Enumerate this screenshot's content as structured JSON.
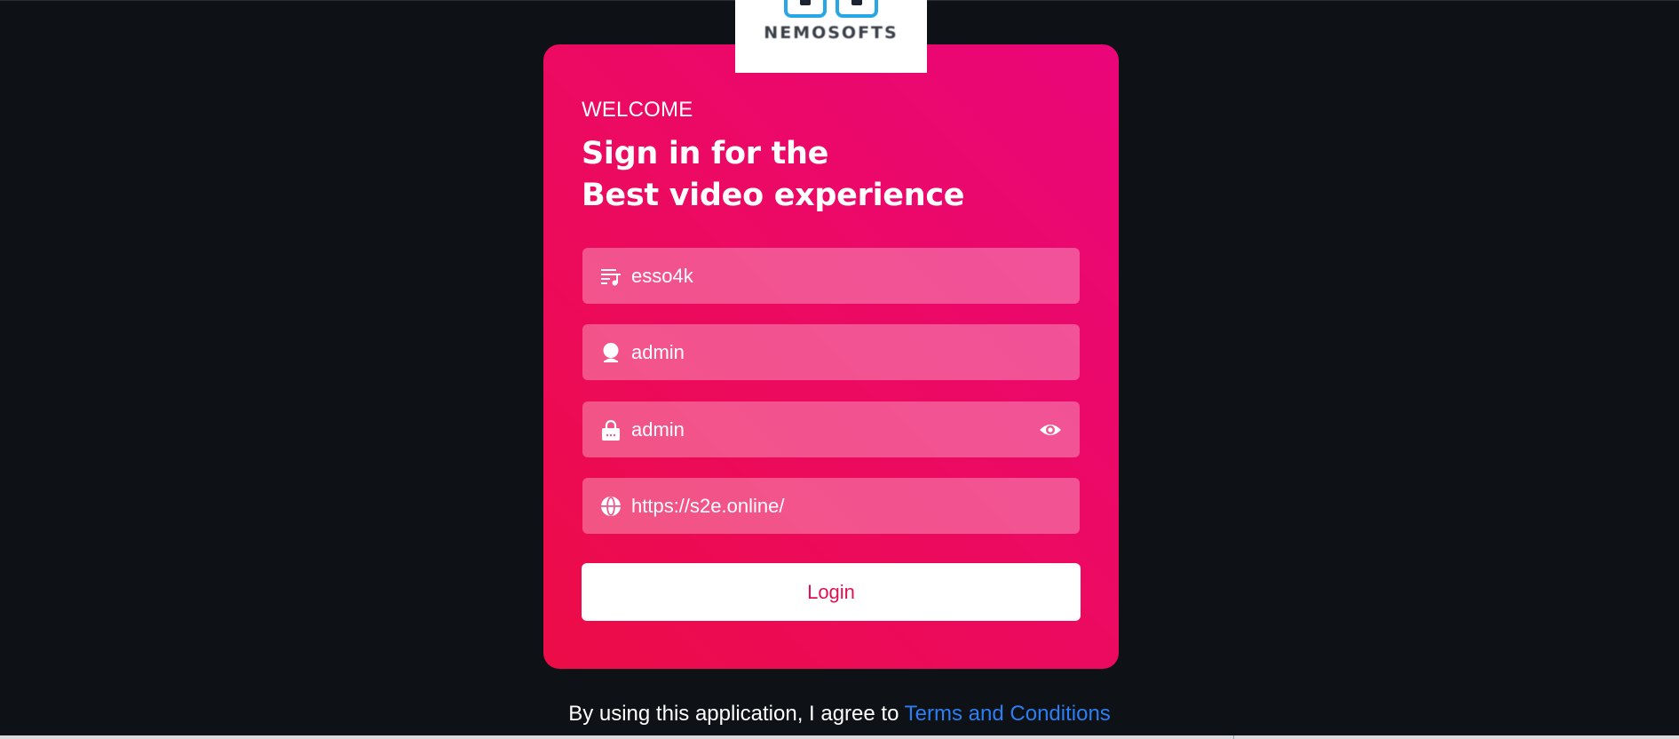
{
  "logo": {
    "brand": "NEMOSOFTS"
  },
  "card": {
    "welcome": "WELCOME",
    "headline_line1": "Sign in for the",
    "headline_line2": "Best video experience"
  },
  "fields": {
    "playlist": {
      "value": "esso4k",
      "icon": "playlist-icon"
    },
    "username": {
      "value": "admin",
      "icon": "user-icon"
    },
    "password": {
      "value": "admin",
      "icon": "lock-icon",
      "toggle_icon": "eye-icon"
    },
    "server_url": {
      "value": "https://s2e.online/",
      "icon": "globe-icon"
    }
  },
  "login_button": {
    "label": "Login"
  },
  "terms": {
    "prefix": "By using this application, I agree to",
    "link": "Terms and Conditions"
  },
  "colors": {
    "background": "#0e1116",
    "card_top": "#ea0679",
    "card_bottom": "#ec0c47",
    "button_text": "#e1104f",
    "link": "#2b7ff3"
  }
}
